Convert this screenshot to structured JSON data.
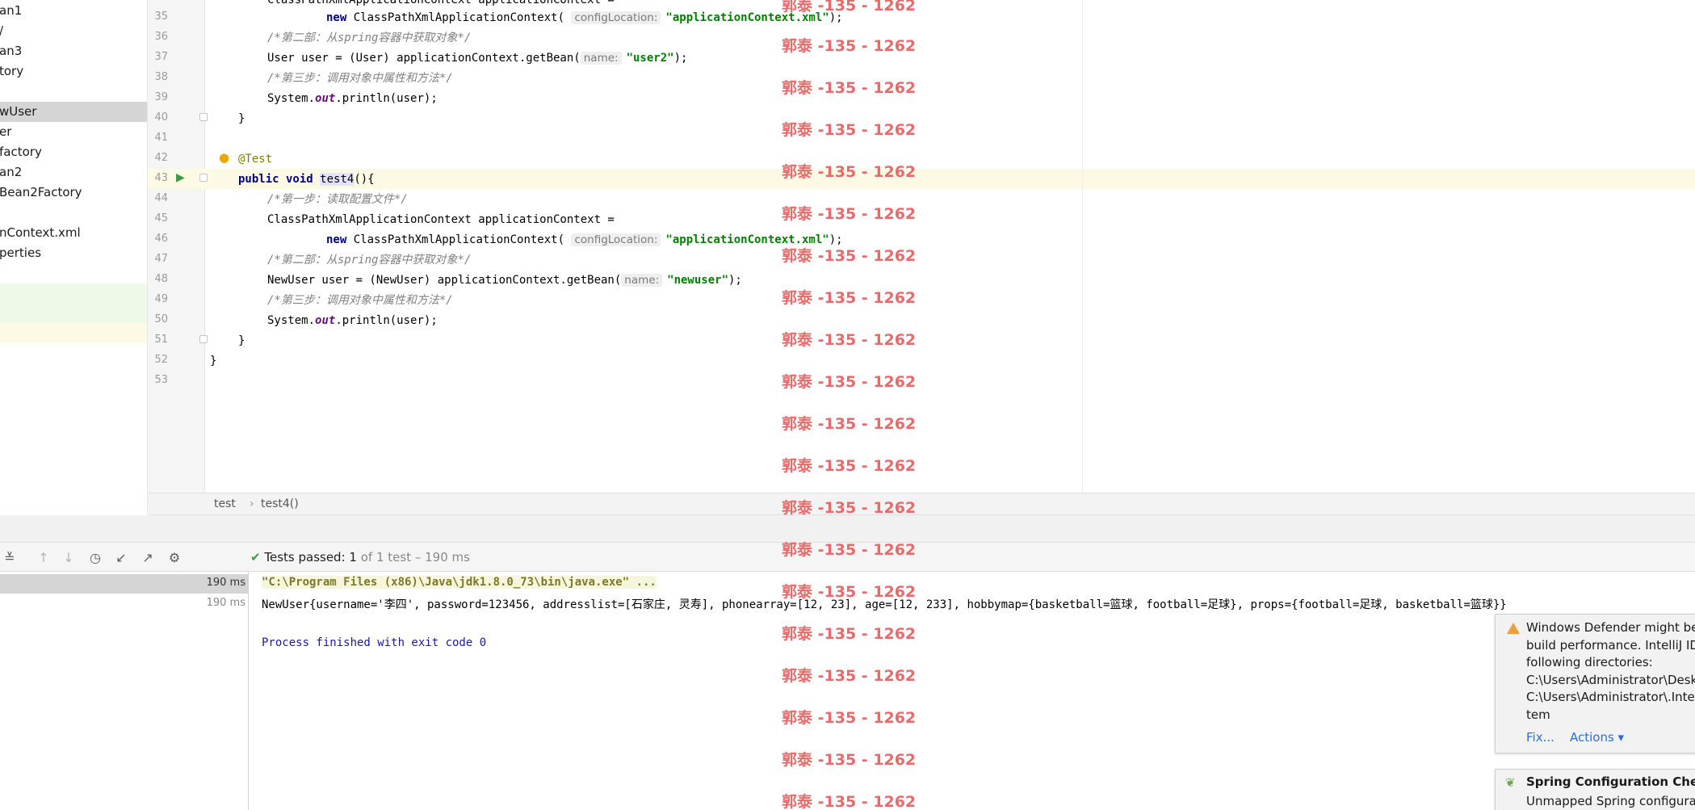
{
  "project_tree": {
    "items": [
      "an1",
      "/",
      "an3",
      "tory",
      "",
      "wUser",
      "er",
      "factory",
      "an2",
      "Bean2Factory",
      "",
      "nContext.xml",
      "perties"
    ],
    "selected_index": 5
  },
  "editor": {
    "line_numbers": [
      "35",
      "36",
      "37",
      "38",
      "39",
      "40",
      "41",
      "42",
      "43",
      "44",
      "45",
      "46",
      "47",
      "48",
      "49",
      "50",
      "51",
      "52",
      "53"
    ],
    "lines": {
      "l34": "ClassPathXmlApplicationContext applicationContext =",
      "l35_new": "new",
      "l35_cls": " ClassPathXmlApplicationContext(",
      "l35_hint": "configLocation:",
      "l35_str": "\"applicationContext.xml\"",
      "l35_end": ");",
      "l36": "/*第二部：从spring容器中获取对象*/",
      "l37_a": "User user = (User) applicationContext.getBean(",
      "l37_hint": "name:",
      "l37_str": "\"user2\"",
      "l37_end": ");",
      "l38": "/*第三步：调用对象中属性和方法*/",
      "l39_a": "System.",
      "l39_out": "out",
      "l39_b": ".println(user);",
      "l40": "}",
      "l42": "@Test",
      "l43_kw": "public void",
      "l43_name": "test4",
      "l43_end": "(){",
      "l44": "/*第一步：读取配置文件*/",
      "l45": "ClassPathXmlApplicationContext applicationContext =",
      "l46_new": "new",
      "l46_cls": " ClassPathXmlApplicationContext(",
      "l46_hint": "configLocation:",
      "l46_str": "\"applicationContext.xml\"",
      "l46_end": ");",
      "l47": "/*第二部：从spring容器中获取对象*/",
      "l48_a": "NewUser user = (NewUser) applicationContext.getBean(",
      "l48_hint": "name:",
      "l48_str": "\"newuser\"",
      "l48_end": ");",
      "l49": "/*第三步：调用对象中属性和方法*/",
      "l50_a": "System.",
      "l50_out": "out",
      "l50_b": ".println(user);",
      "l51": "}",
      "l52": "}"
    }
  },
  "breadcrumb": {
    "class": "test",
    "separator": "›",
    "method": "test4()"
  },
  "run": {
    "status_prefix": "Tests passed:",
    "status_count": "1",
    "status_rest": "of 1 test – 190 ms",
    "durations": [
      "190 ms",
      "190 ms"
    ],
    "console": {
      "cmd": "\"C:\\Program Files (x86)\\Java\\jdk1.8.0_73\\bin\\java.exe\" ...",
      "output": "NewUser{username='李四', password=123456, addresslist=[石家庄, 灵寿], phonearray=[12, 23], age=[12, 233], hobbymap={basketball=篮球, football=足球}, props={football=足球, basketball=篮球}}",
      "exit": "Process finished with exit code 0"
    }
  },
  "watermark": "郭泰 -135 - 1262",
  "notifications": {
    "defender": {
      "text": "Windows Defender might be\nbuild performance. IntelliJ ID\nfollowing directories:\nC:\\Users\\Administrator\\Desk\nC:\\Users\\Administrator\\.Intel\ntem",
      "fix": "Fix...",
      "actions": "Actions ▾"
    },
    "spring": {
      "title": "Spring Configuration Check",
      "text": "Unmapped Spring configura"
    }
  },
  "colors": {
    "accent": "#2a6fd6",
    "watermark": "#e86b6b",
    "pass": "#3c9a3c"
  }
}
